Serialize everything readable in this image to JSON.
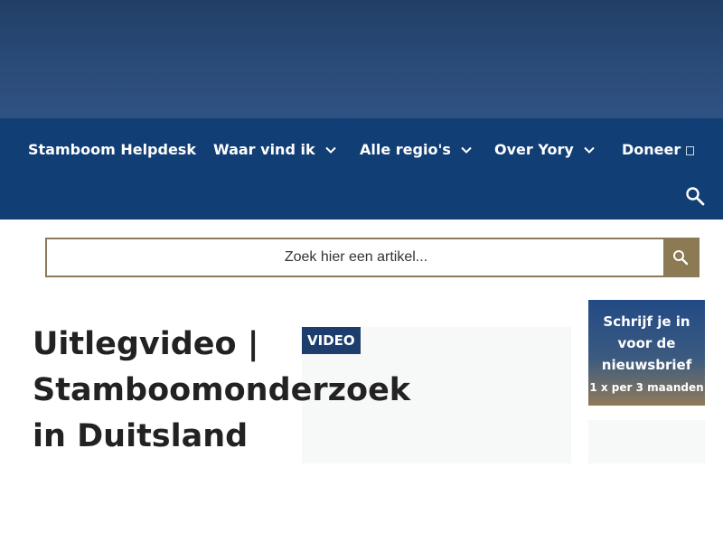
{
  "nav": {
    "items": [
      {
        "label": "Stamboom Helpdesk"
      },
      {
        "label": "Waar vind ik"
      },
      {
        "label": "Alle regio's"
      },
      {
        "label": "Over Yory"
      },
      {
        "label": "Doneer"
      }
    ],
    "search_icon": "search-icon",
    "dropdown_icon": "chevron-down-icon"
  },
  "search": {
    "placeholder": "Zoek hier een artikel...",
    "button_icon": "search-icon"
  },
  "article": {
    "title": "Uitlegvideo | Stamboomonderzoek in Duitsland",
    "badge": "VIDEO"
  },
  "newsletter": {
    "title": "Schrijf je in voor de nieuwsbrief",
    "frequency": "1 x per 3 maanden"
  },
  "colors": {
    "nav_background": "#113e74",
    "search_button": "#8b7a52",
    "badge_background": "#1d3e6c"
  }
}
